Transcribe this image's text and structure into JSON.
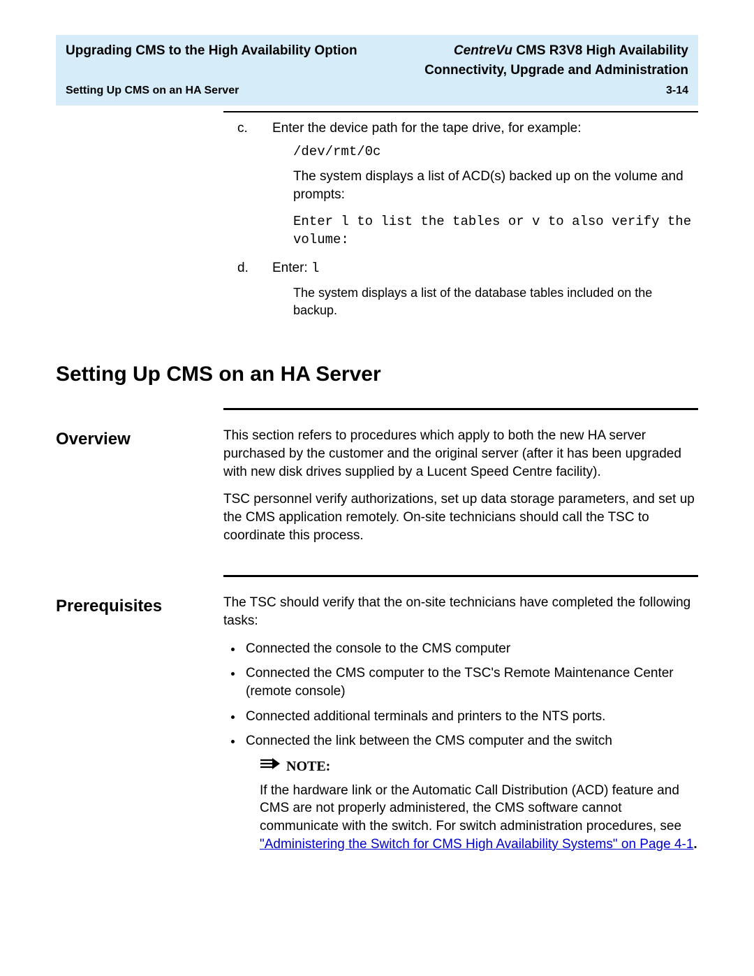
{
  "header": {
    "left_title": "Upgrading CMS to the High Availability Option",
    "right_title_prefix_italic": "CentreVu",
    "right_title_rest": " CMS R3V8 High Availability",
    "right_subtitle": "Connectivity, Upgrade and Administration",
    "left_small": "Setting Up CMS on an HA Server",
    "page_num": "3-14"
  },
  "steps": {
    "c": {
      "letter": "c.",
      "intro": "Enter the device path for the tape drive, for example:",
      "code": "/dev/rmt/0c",
      "after1": "The system displays a list of ACD(s) backed up on the volume and prompts:",
      "prompt": "Enter l to list the tables or v to also verify the volume:"
    },
    "d": {
      "letter": "d.",
      "intro_pre": "Enter: ",
      "intro_code": "l",
      "after": " The system displays a list of the database tables included on the backup."
    }
  },
  "section_title": "Setting Up CMS on an HA Server",
  "overview": {
    "head": "Overview",
    "p1": "This section refers to procedures which apply to both the new HA server purchased by the customer and the original server (after it has been upgraded with new disk drives supplied by a Lucent Speed Centre facility).",
    "p2": "TSC personnel verify authorizations, set up data storage parameters, and set up the CMS application remotely. On-site technicians should call the TSC to coordinate this process."
  },
  "prereq": {
    "head": "Prerequisites",
    "intro": "The TSC should verify that the on-site technicians have completed the following tasks:",
    "items": [
      "Connected the console to the CMS computer",
      "Connected the CMS computer to the TSC's Remote Maintenance Center (remote console)",
      "Connected additional terminals and printers to the NTS ports.",
      "Connected the link between the CMS computer and the switch"
    ],
    "note_label": "NOTE:",
    "note_text_pre": "If the hardware link or the Automatic Call Distribution (ACD) feature and CMS are not properly administered, the CMS software cannot communicate with the switch. For switch administration procedures, see ",
    "note_link": "\"Administering the Switch for CMS High Availability Systems\" on Page 4-1",
    "note_text_post": "."
  }
}
